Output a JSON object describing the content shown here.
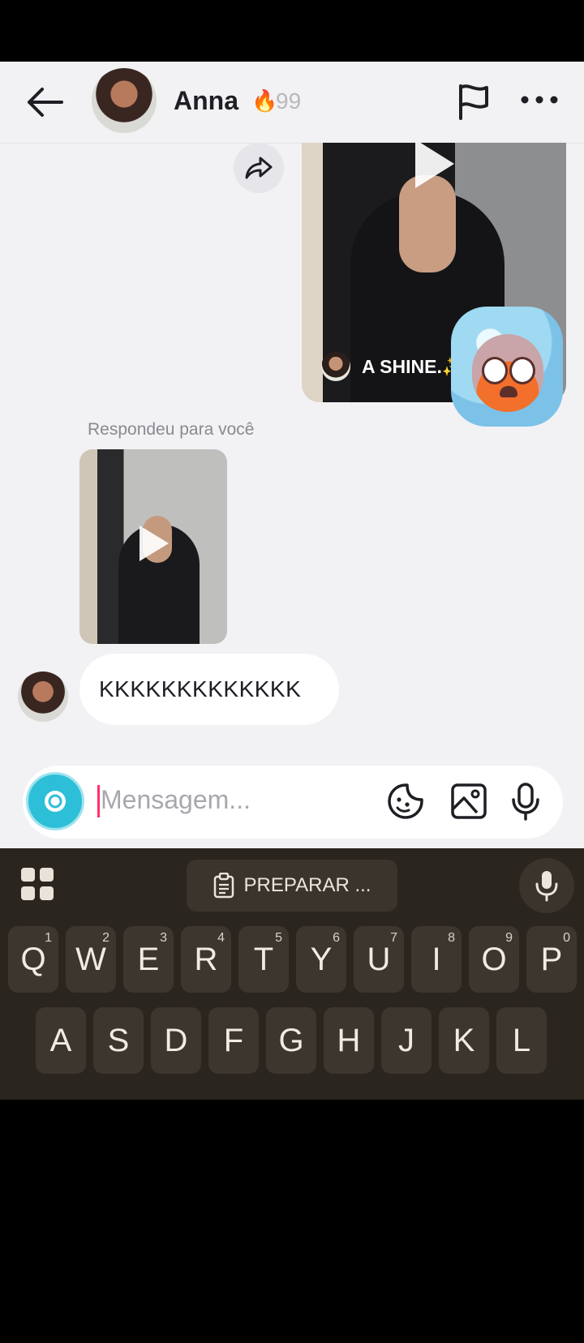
{
  "header": {
    "contact_name": "Anna",
    "streak_icon": "flame-icon",
    "streak_count": "99"
  },
  "chat": {
    "shared_video_caption": "A SHINE.",
    "sparkle": "✨",
    "replied_label": "Respondeu para você",
    "last_message": "KKKKKKKKKKKKK"
  },
  "composer": {
    "placeholder": "Mensagem..."
  },
  "keyboard": {
    "suggestion": "PREPARAR ...",
    "row1": [
      {
        "key": "Q",
        "num": "1"
      },
      {
        "key": "W",
        "num": "2"
      },
      {
        "key": "E",
        "num": "3"
      },
      {
        "key": "R",
        "num": "4"
      },
      {
        "key": "T",
        "num": "5"
      },
      {
        "key": "Y",
        "num": "6"
      },
      {
        "key": "U",
        "num": "7"
      },
      {
        "key": "I",
        "num": "8"
      },
      {
        "key": "O",
        "num": "9"
      },
      {
        "key": "P",
        "num": "0"
      }
    ],
    "row2": [
      "A",
      "S",
      "D",
      "F",
      "G",
      "H",
      "J",
      "K",
      "L"
    ]
  },
  "colors": {
    "background": "#f2f1f4",
    "camera_button": "#2dbfd8",
    "keyboard": "#2a251f",
    "caret": "#ff2f6a"
  }
}
